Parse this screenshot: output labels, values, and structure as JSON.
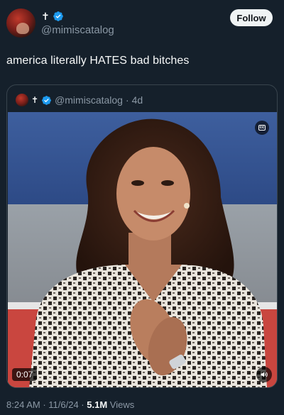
{
  "author": {
    "name_symbol": "✝",
    "handle": "@mimiscatalog",
    "follow_label": "Follow"
  },
  "tweet": {
    "text": "america literally HATES bad bitches"
  },
  "quoted": {
    "name_symbol": "✝",
    "handle": "@mimiscatalog",
    "separator": "·",
    "age": "4d",
    "video": {
      "duration": "0:07",
      "cc_label": "cc"
    }
  },
  "meta": {
    "time": "8:24 AM",
    "sep1": " · ",
    "date": "11/6/24",
    "sep2": " · ",
    "views_count": "5.1M",
    "views_label": " Views"
  },
  "colors": {
    "background": "#15202b",
    "verified": "#1d9bf0",
    "muted_text": "#8b98a5"
  },
  "icons": [
    "verified-badge-icon",
    "closed-captions-icon",
    "speaker-mute-icon"
  ]
}
